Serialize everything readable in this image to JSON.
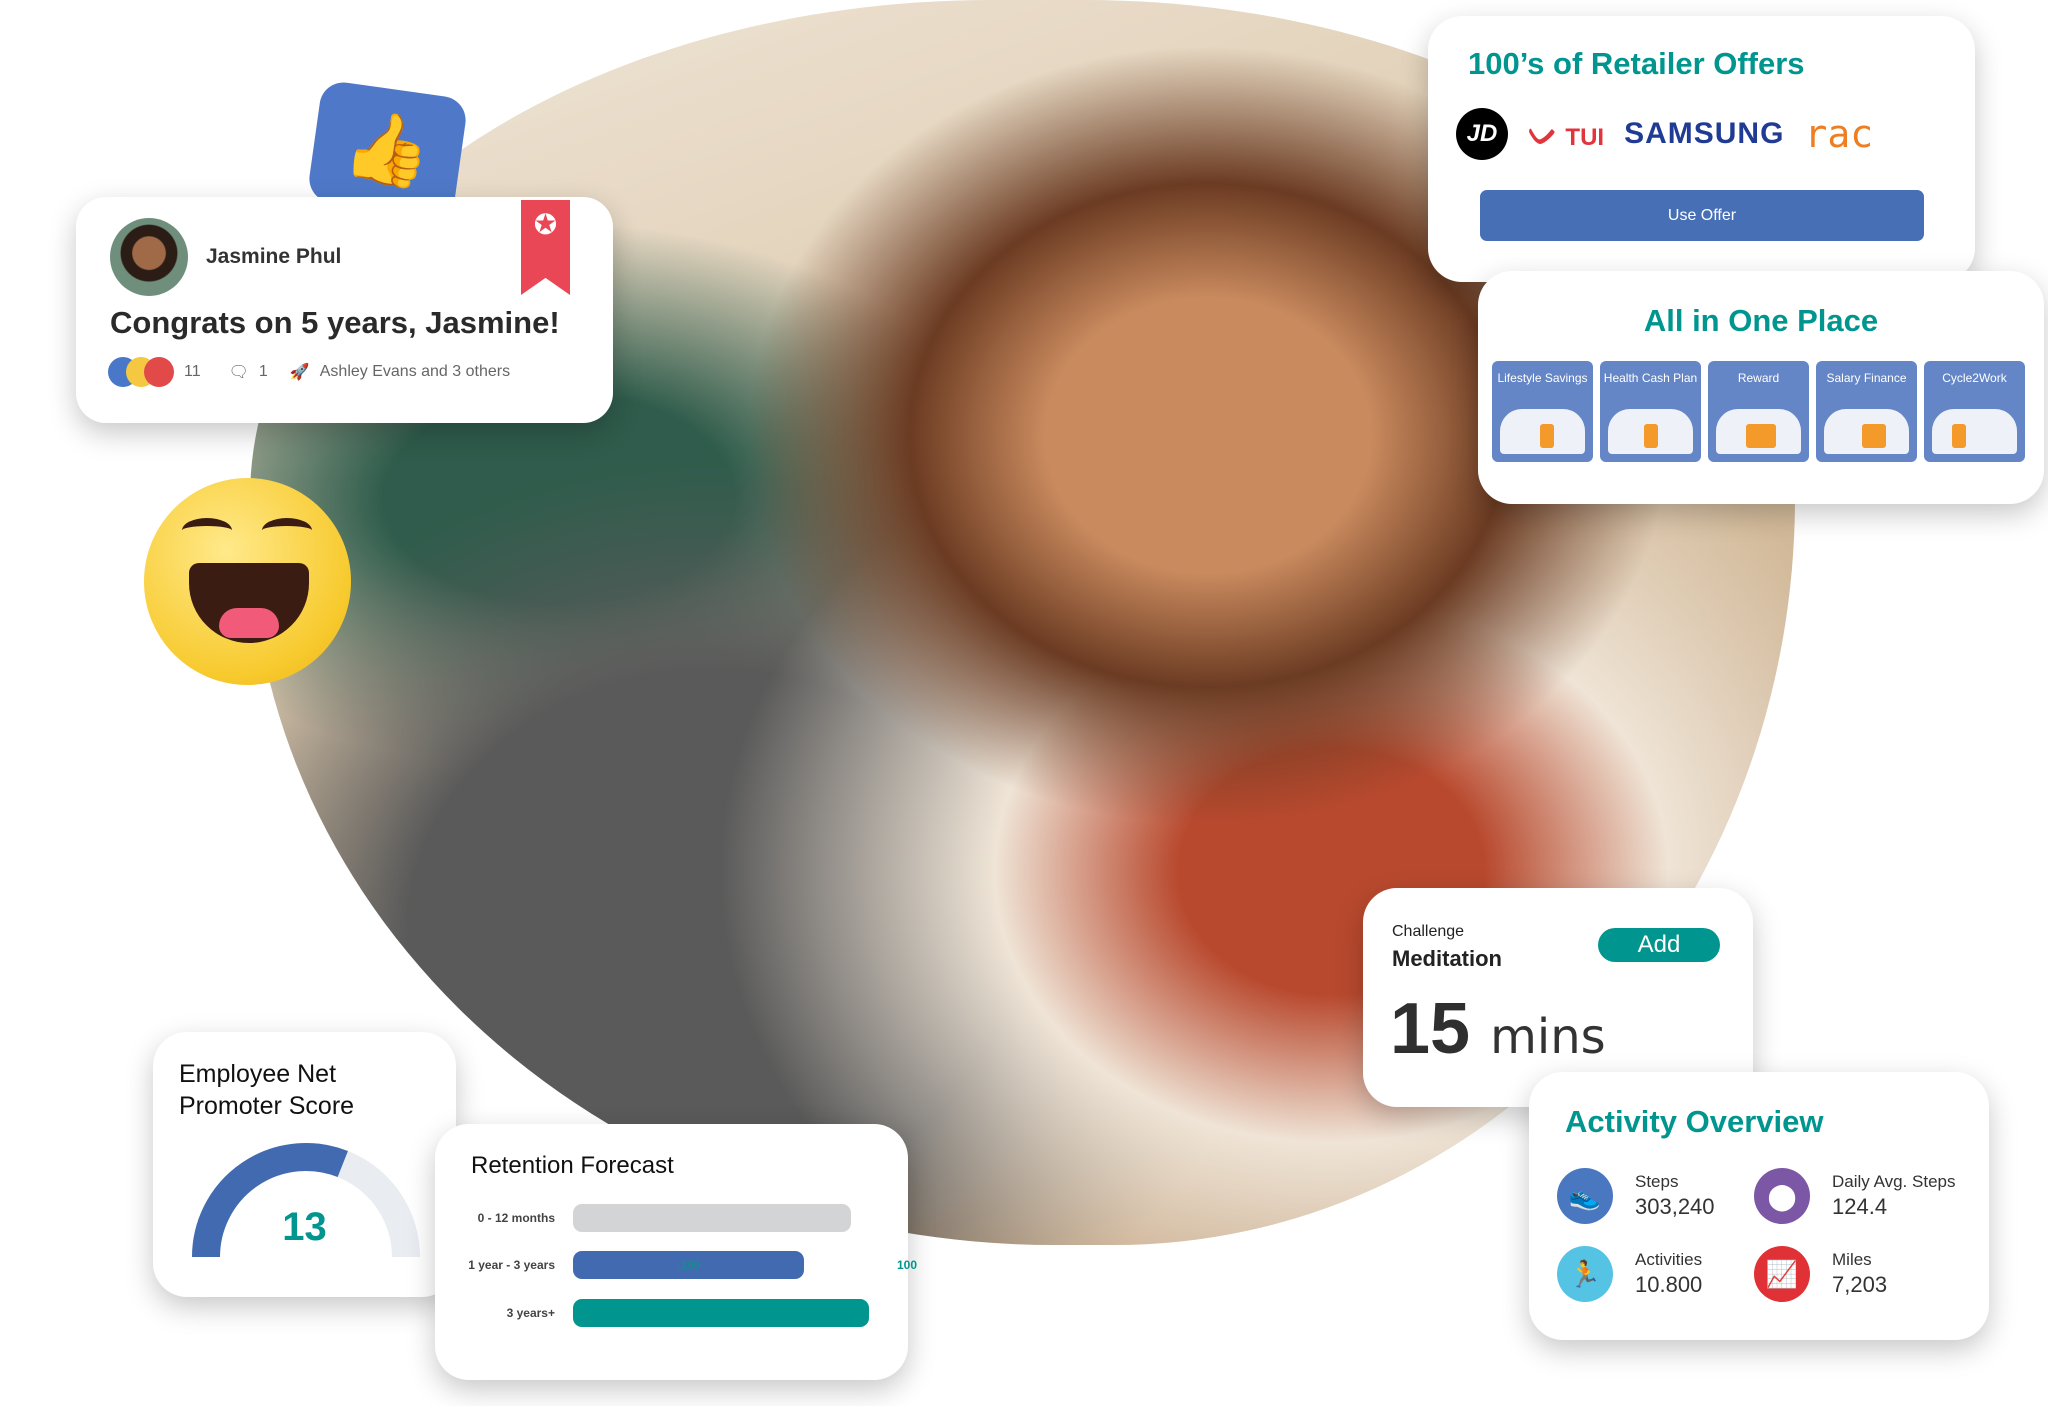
{
  "recognition_post": {
    "author": "Jasmine Phul",
    "message": "Congrats on 5 years, Jasmine!",
    "reaction_count": "11",
    "comment_count": "1",
    "shared_by": "Ashley Evans and 3 others"
  },
  "retailer_offers": {
    "title": "100’s of Retailer Offers",
    "logos": [
      "JD",
      "TUI",
      "SAMSUNG",
      "RAC"
    ],
    "button": "Use Offer",
    "button_color": "#466fb6"
  },
  "all_in_one": {
    "title": "All in One Place",
    "tiles": [
      "Lifestyle Savings",
      "Health Cash Plan",
      "Reward",
      "Salary Finance",
      "Cycle2Work"
    ]
  },
  "challenge": {
    "label": "Challenge",
    "name": "Meditation",
    "add_button": "Add",
    "duration_value": "15",
    "duration_unit": "mins"
  },
  "activity": {
    "title": "Activity Overview",
    "stats": [
      {
        "label": "Steps",
        "value": "303,240",
        "icon": "shoe-icon",
        "color": "#4a78c0"
      },
      {
        "label": "Daily Avg. Steps",
        "value": "124.4",
        "icon": "location-pin-icon",
        "color": "#7b57a6"
      },
      {
        "label": "Activities",
        "value": "10.800",
        "icon": "running-person-icon",
        "color": "#55c3e4"
      },
      {
        "label": "Miles",
        "value": "7,203",
        "icon": "line-chart-icon",
        "color": "#e03236"
      }
    ]
  },
  "enps": {
    "title_line1": "Employee Net",
    "title_line2": "Promoter Score",
    "score": "13",
    "gauge_fill": 0.62,
    "gauge_color": "#416ab0"
  },
  "retention": {
    "title": "Retention Forecast",
    "inner_label": "-100",
    "axis_label": "100",
    "rows": [
      {
        "label": "0 - 12 months",
        "fill": 0.94,
        "color": "#d3d4d6"
      },
      {
        "label": "1 year - 3 years",
        "fill": 0.78,
        "color": "#416ab0"
      },
      {
        "label": "3 years+",
        "fill": 1.0,
        "color": "#00968f"
      }
    ]
  }
}
